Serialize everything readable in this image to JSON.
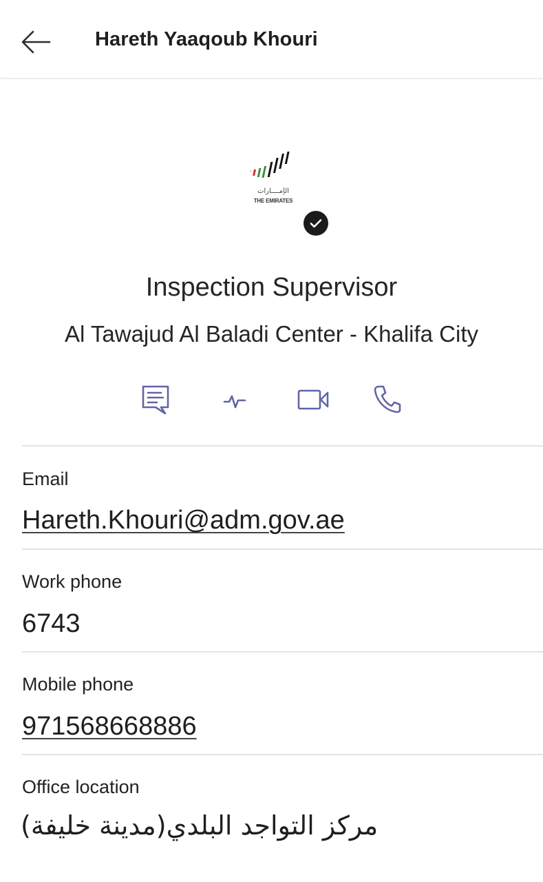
{
  "header": {
    "back_icon": "arrow-left-icon",
    "title": "Hareth Yaaqoub Khouri"
  },
  "profile": {
    "logo": {
      "arabic_text": "الإمــــارات",
      "english_text": "THE EMIRATES",
      "colors": [
        "#d32f2f",
        "#3a8f3a",
        "#111111"
      ]
    },
    "verified_icon": "check-circle-icon",
    "job_title": "Inspection Supervisor",
    "department": "Al Tawajud Al Baladi Center - Khalifa City"
  },
  "actions": [
    {
      "name": "chat",
      "icon": "chat-icon"
    },
    {
      "name": "activity",
      "icon": "activity-pulse-icon"
    },
    {
      "name": "video-call",
      "icon": "video-camera-icon"
    },
    {
      "name": "call",
      "icon": "phone-icon"
    }
  ],
  "accent_color": "#6264a7",
  "details": {
    "email": {
      "label": "Email",
      "value": "Hareth.Khouri@adm.gov.ae"
    },
    "work_phone": {
      "label": "Work phone",
      "value": "6743"
    },
    "mobile_phone": {
      "label": "Mobile phone",
      "value": "971568668886"
    },
    "office_location": {
      "label": "Office location",
      "value": "مركز التواجد البلدي(مدينة خليفة)"
    }
  }
}
